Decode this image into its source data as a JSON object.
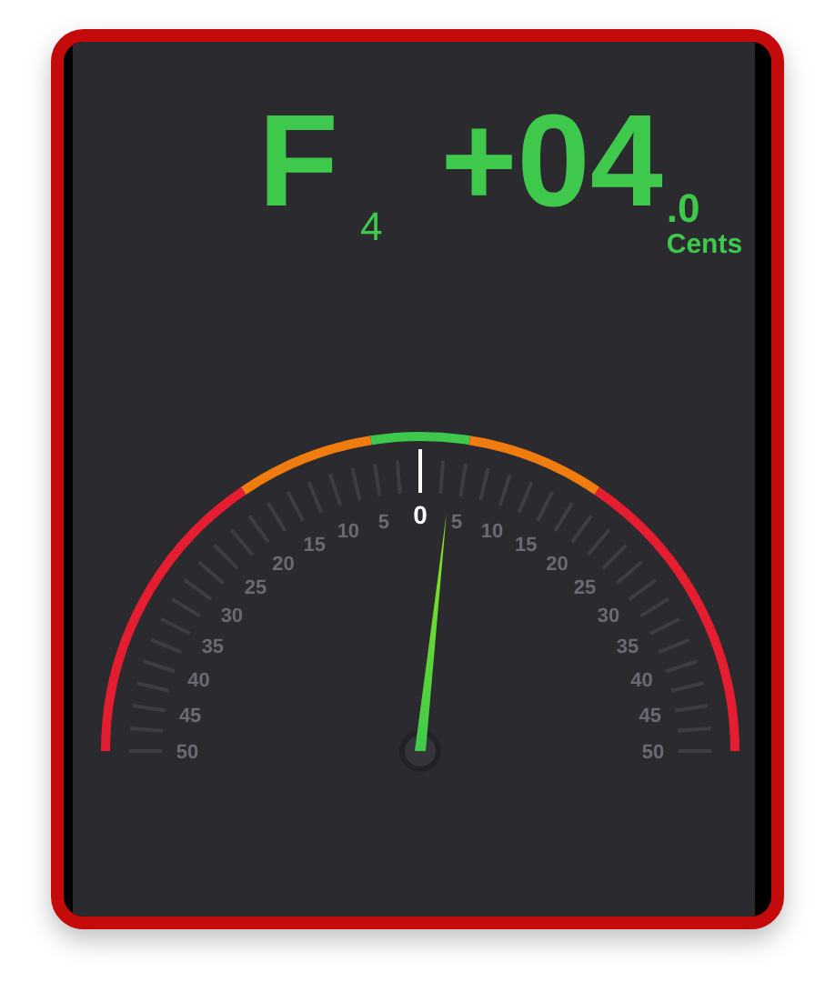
{
  "note": {
    "name": "F",
    "octave": "4"
  },
  "cents": {
    "value": "+04",
    "decimal": ".0",
    "unit": "Cents"
  },
  "gauge": {
    "left_labels": [
      "5",
      "10",
      "15",
      "20",
      "25",
      "30",
      "35",
      "40",
      "45",
      "50"
    ],
    "center_label": "0",
    "right_labels": [
      "5",
      "10",
      "15",
      "20",
      "25",
      "30",
      "35",
      "40",
      "45",
      "50"
    ]
  }
}
